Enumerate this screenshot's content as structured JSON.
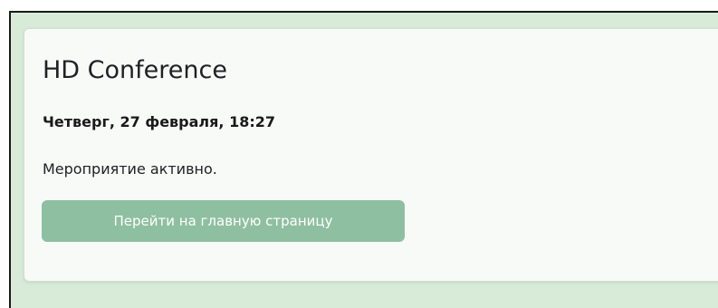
{
  "event": {
    "title": "HD Conference",
    "datetime": "Четверг, 27 февраля, 18:27",
    "status": "Мероприятие активно."
  },
  "actions": {
    "home_button_label": "Перейти на главную страницу"
  },
  "colors": {
    "page_background": "#d8ebd9",
    "card_background": "#f8faf8",
    "button_background": "#8fbfa1",
    "button_text": "#ffffff"
  }
}
